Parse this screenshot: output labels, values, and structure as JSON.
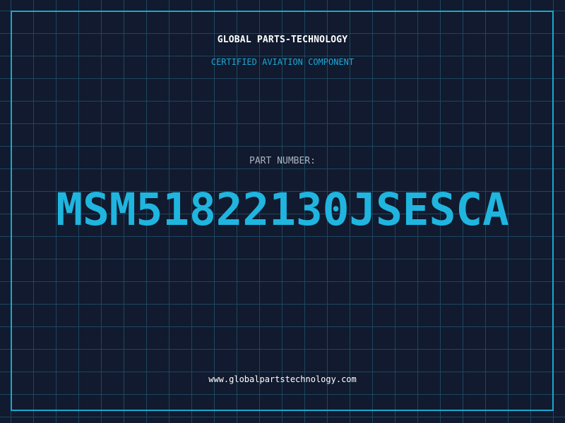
{
  "header": {
    "company": "GLOBAL PARTS-TECHNOLOGY",
    "tagline": "CERTIFIED AVIATION COMPONENT"
  },
  "part": {
    "label": "PART NUMBER:",
    "number": "MSM51822130JSESCA"
  },
  "footer": {
    "website": "www.globalpartstechnology.com"
  },
  "colors": {
    "background": "#111a2e",
    "grid": "#1e4660",
    "accent": "#1fb5df",
    "frame": "#17a7cf"
  }
}
